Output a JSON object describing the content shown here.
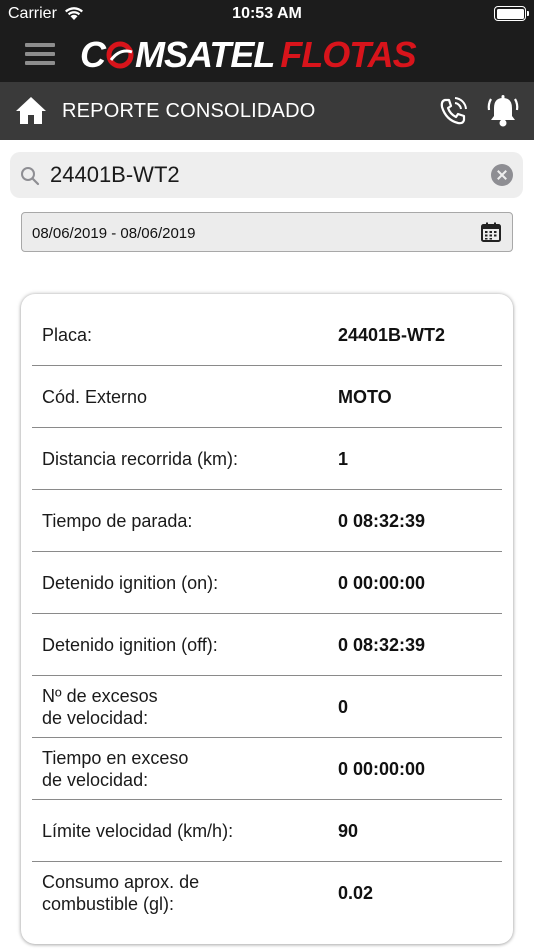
{
  "status_bar": {
    "carrier": "Carrier",
    "time": "10:53 AM",
    "battery_level": 1.0
  },
  "header": {
    "logo_part1": "C MSATEL",
    "logo_part2": "FLOTAS",
    "brand_color": "#d8141b",
    "menu_icon": "hamburger-icon"
  },
  "sub_header": {
    "title": "REPORTE CONSOLIDADO",
    "home_icon": "home-icon",
    "phone_icon": "phone-ring-icon",
    "bell_icon": "bell-icon"
  },
  "search": {
    "value": "24401B-WT2",
    "icon": "search-icon"
  },
  "date_range": {
    "text": "08/06/2019 - 08/06/2019",
    "icon": "calendar-icon"
  },
  "report": {
    "rows": [
      {
        "label": "Placa:",
        "value": "24401B-WT2"
      },
      {
        "label": "Cód. Externo",
        "value": "MOTO"
      },
      {
        "label": "Distancia recorrida (km):",
        "value": "1"
      },
      {
        "label": "Tiempo de parada:",
        "value": "0 08:32:39"
      },
      {
        "label": "Detenido ignition (on):",
        "value": "0 00:00:00"
      },
      {
        "label": "Detenido ignition (off):",
        "value": "0 08:32:39"
      },
      {
        "label": "Nº de excesos\nde velocidad:",
        "value": "0"
      },
      {
        "label": "Tiempo en exceso\nde velocidad:",
        "value": "0 00:00:00"
      },
      {
        "label": "Límite velocidad (km/h):",
        "value": "90"
      },
      {
        "label": "Consumo aprox. de\ncombustible (gl):",
        "value": "0.02"
      }
    ]
  }
}
